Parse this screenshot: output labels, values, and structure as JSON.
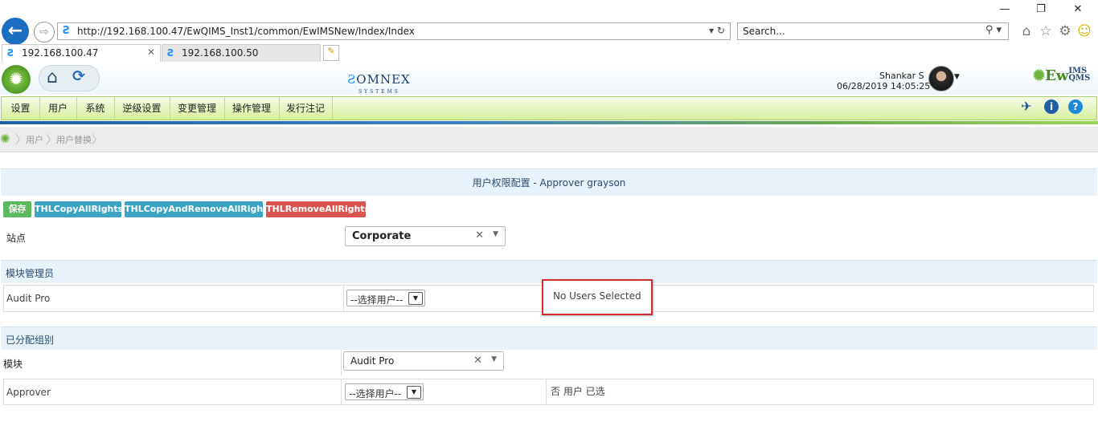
{
  "browser": {
    "url": "http://192.168.100.47/EwQIMS_Inst1/common/EwIMSNew/Index/Index",
    "search_placeholder": "Search...",
    "tabs": [
      {
        "label": "192.168.100.47"
      },
      {
        "label": "192.168.100.50"
      }
    ]
  },
  "header": {
    "omnex_text": "OMNEX",
    "omnex_sub": "SYSTEMS",
    "user_name": "Shankar S",
    "datetime": "06/28/2019 14:05:25",
    "brand_main": "Ew",
    "brand_ims": "IMS",
    "brand_qms": "QMS"
  },
  "menu": {
    "items": [
      "设置",
      "用户",
      "系统",
      "逆级设置",
      "变更管理",
      "操作管理",
      "发行注记"
    ]
  },
  "breadcrumb": {
    "items": [
      "用户",
      "用户替换"
    ]
  },
  "panel": {
    "title": "用户权限配置 - Approver grayson"
  },
  "buttons": {
    "save": "保存",
    "copy_all": "THLCopyAllRights",
    "copy_remove_all": "THLCopyAndRemoveAllRights",
    "remove_all": "THLRemoveAllRights"
  },
  "site": {
    "label": "站点",
    "value": "Corporate"
  },
  "module_admin": {
    "header": "模块管理员",
    "row_label": "Audit Pro",
    "select_value": "--选择用户--",
    "no_users": "No Users Selected"
  },
  "assigned_groups": {
    "header": "已分配组别",
    "module_label": "模块",
    "module_value": "Audit Pro",
    "row_label": "Approver",
    "select_value": "--选择用户--",
    "status_text": "否 用户 已选"
  },
  "colors": {
    "save": "#5cb85c",
    "info": "#3ba4c4",
    "danger": "#d9534f"
  }
}
